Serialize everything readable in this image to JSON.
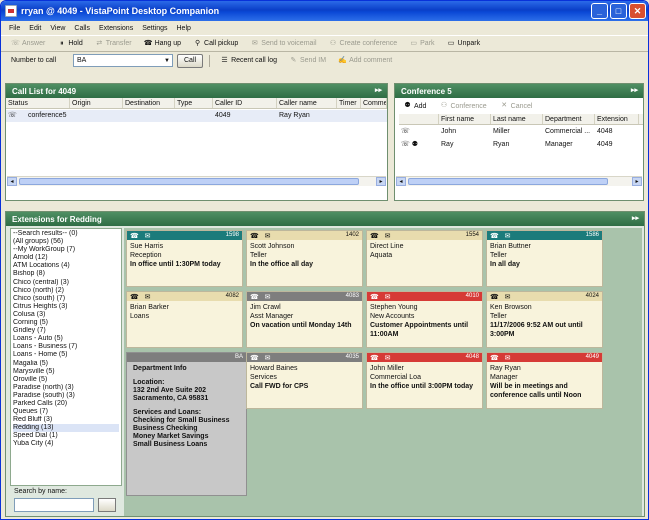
{
  "window": {
    "title": "rryan @ 4049 - VistaPoint Desktop Companion"
  },
  "menu": [
    "File",
    "Edit",
    "View",
    "Calls",
    "Extensions",
    "Settings",
    "Help"
  ],
  "toolbar": {
    "buttons": [
      {
        "label": "Answer",
        "enabled": false,
        "icon": "answer-icon"
      },
      {
        "label": "Hold",
        "enabled": true,
        "icon": "hold-icon"
      },
      {
        "label": "Transfer",
        "enabled": false,
        "icon": "transfer-icon"
      },
      {
        "label": "Hang up",
        "enabled": true,
        "icon": "hangup-icon"
      },
      {
        "label": "Call pickup",
        "enabled": true,
        "icon": "pickup-icon"
      },
      {
        "label": "Send to voicemail",
        "enabled": false,
        "icon": "voicemail-icon"
      },
      {
        "label": "Create conference",
        "enabled": false,
        "icon": "conference-icon"
      },
      {
        "label": "Park",
        "enabled": false,
        "icon": "park-icon"
      },
      {
        "label": "Unpark",
        "enabled": true,
        "icon": "unpark-icon"
      }
    ]
  },
  "toolbar2": {
    "number_label": "Number to call",
    "number_value": "BA",
    "call_label": "Call",
    "recent_label": "Recent call log",
    "sendim_label": "Send IM",
    "comment_label": "Add comment"
  },
  "call_list": {
    "title": "Call List for  4049",
    "columns": [
      "Status",
      "Origin",
      "Destination",
      "Type",
      "Caller ID",
      "Caller name",
      "Timer",
      "Comme"
    ],
    "rows": [
      {
        "status": "",
        "origin": "conference5",
        "destination": "",
        "type": "",
        "caller_id": "4049",
        "caller_name": "Ray Ryan",
        "timer": ""
      }
    ]
  },
  "conference": {
    "title": "Conference 5",
    "add_label": "Add",
    "conference_label": "Conference",
    "cancel_label": "Cancel",
    "columns": [
      "",
      "First name",
      "Last name",
      "Department",
      "Extension"
    ],
    "rows": [
      {
        "first": "John",
        "last": "Miller",
        "dept": "Commercial ...",
        "ext": "4048"
      },
      {
        "first": "Ray",
        "last": "Ryan",
        "dept": "Manager",
        "ext": "4049"
      }
    ]
  },
  "extensions": {
    "title": "Extensions for Redding",
    "tree": [
      "--Search results-- (0)",
      "(All groups) (56)",
      "--My WorkGroup (7)",
      "Arnold (12)",
      "ATM Locations (4)",
      "Bishop (8)",
      "Chico (central) (3)",
      "Chico (north) (2)",
      "Chico (south) (7)",
      "Citrus Heights (3)",
      "Colusa (3)",
      "Corning (5)",
      "Gridley (7)",
      "Loans - Auto (5)",
      "Loans - Business (7)",
      "Loans - Home (5)",
      "Magalia (5)",
      "Marysville (5)",
      "Oroville (5)",
      "Paradise (north) (3)",
      "Paradise (south) (3)",
      "Parked Calls (20)",
      "Queues (7)",
      "Red Bluff (3)",
      "Redding (13)",
      "Speed Dial (1)",
      "Yuba City (4)"
    ],
    "selected_tree": "Redding (13)",
    "search_label": "Search by name:",
    "cards": [
      {
        "ext": "1598",
        "name": "Sue Harris",
        "title": "Reception",
        "status": "In office until 1:30PM today",
        "color": "teal"
      },
      {
        "ext": "1402",
        "name": "Scott Johnson",
        "title": "Teller",
        "status": "In the office all day",
        "color": "tan"
      },
      {
        "ext": "1554",
        "name": "Direct Line",
        "title": "Aquata",
        "status": "",
        "color": "tan"
      },
      {
        "ext": "1586",
        "name": "Brian Buttner",
        "title": "Teller",
        "status": "In all day",
        "color": "teal"
      },
      {
        "ext": "4082",
        "name": "Brian Barker",
        "title": "Loans",
        "status": "",
        "color": "tan"
      },
      {
        "ext": "4083",
        "name": "Jim Crawl",
        "title": "Asst Manager",
        "status": "On vacation until Monday 14th",
        "color": "gray"
      },
      {
        "ext": "4010",
        "name": "Stephen Young",
        "title": "New Accounts",
        "status": "Customer Appointments until 11:00AM",
        "color": "red"
      },
      {
        "ext": "4024",
        "name": "Ken Browson",
        "title": "Teller",
        "status": "11/17/2006 9:52 AM out until 3:00PM",
        "color": "tan"
      },
      {
        "ext": "4035",
        "name": "Howard Baines",
        "title": "Services",
        "status": "Call FWD for CPS",
        "color": "gray"
      },
      {
        "ext": "4048",
        "name": "John Miller",
        "title": "Commercial Loa",
        "status": "In the office until 3:00PM today",
        "color": "red"
      },
      {
        "ext": "4049",
        "name": "Ray Ryan",
        "title": "Manager",
        "status": "Will be in meetings and conference calls until Noon",
        "color": "red"
      }
    ],
    "dept": {
      "ext": "BA",
      "heading": "Department Info",
      "loc_label": "Location:",
      "addr1": "132 2nd Ave Suite 202",
      "addr2": "Sacramento, CA 95831",
      "services_label": "Services and Loans:",
      "services": [
        "Checking for Small Business",
        "Business Checking",
        "Money Market Savings",
        "Small Business Loans"
      ]
    }
  },
  "colors": {
    "panel_header": "#2f6d45",
    "teal_bar": "#1c7b7b",
    "red_bar": "#d63a36",
    "tan_bar": "#e8dcae",
    "card_bg": "#f8f3dc",
    "cards_bg": "#a9c3ab"
  }
}
